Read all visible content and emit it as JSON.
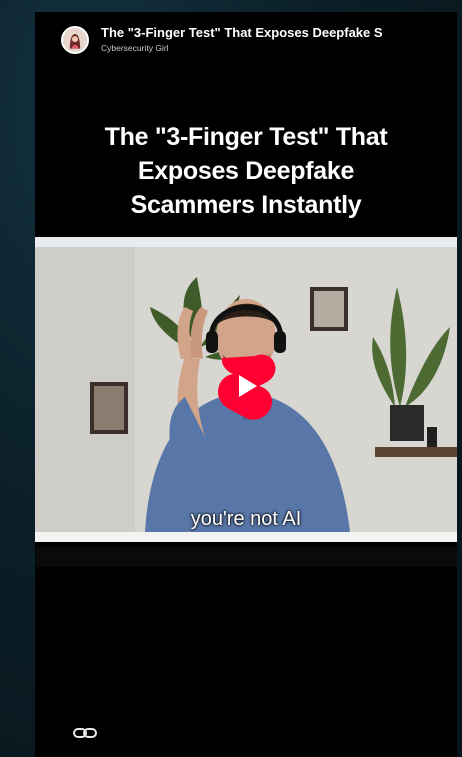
{
  "header": {
    "title": "The \"3-Finger Test\" That Exposes Deepfake S",
    "channel": "Cybersecurity Girl"
  },
  "headline": {
    "line1": "The \"3-Finger Test\" That",
    "line2": "Exposes Deepfake",
    "line3": "Scammers Instantly"
  },
  "video": {
    "caption": "you're not AI"
  },
  "icons": {
    "play": "youtube-shorts-play-icon",
    "link": "link-icon"
  },
  "colors": {
    "background": "#0b1f28",
    "play_red": "#ff0033"
  }
}
